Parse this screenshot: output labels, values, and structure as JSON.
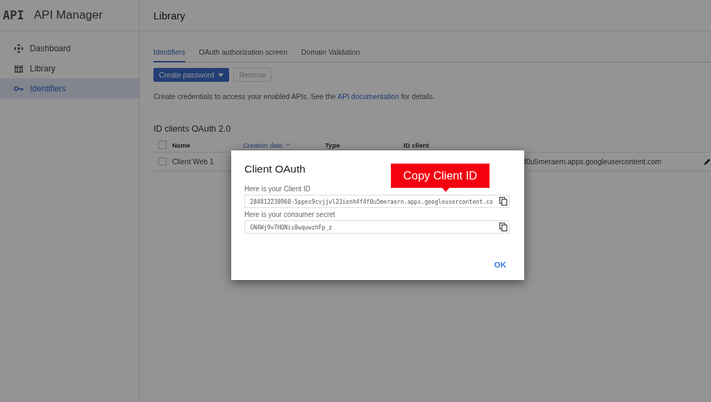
{
  "app": {
    "logo": "API",
    "title": "API Manager"
  },
  "sidebar": {
    "items": [
      {
        "label": "Dashboard",
        "selected": false
      },
      {
        "label": "Library",
        "selected": false
      },
      {
        "label": "Identifiers",
        "selected": true
      }
    ]
  },
  "page": {
    "title": "Library"
  },
  "tabs": [
    {
      "label": "Identifiers",
      "selected": true
    },
    {
      "label": "OAuth authorization screen",
      "selected": false
    },
    {
      "label": "Domain Validation",
      "selected": false
    }
  ],
  "toolbar": {
    "create_button": "Create password",
    "remove_button": {
      "label": "Remove",
      "disabled": true
    }
  },
  "intro": {
    "before": "Create credentials to access your enabled APIs. See the",
    "link": "API documentation",
    "after": "for details."
  },
  "table": {
    "title": "ID clients OAuth 2.0",
    "all_checked": false,
    "columns": [
      {
        "label": "Name",
        "sorted": false
      },
      {
        "label": "Creation date",
        "sorted": true
      },
      {
        "label": "Type",
        "sorted": false
      },
      {
        "label": "ID client",
        "sorted": false
      }
    ],
    "rows": [
      {
        "name": "Client Web 1",
        "id_client": "f0u5meraern.apps.googleusercontent.com",
        "checked": false
      }
    ]
  },
  "dialog": {
    "title": "Client OAuth",
    "fields": [
      {
        "label": "Here is your Client ID",
        "value": "284812238960-5ppes9cvjjvl23ionh4f4f0u5meraern.apps.googleusercontent.co"
      },
      {
        "label": "Here is your consumer secret",
        "value": "GN4Wj9v7HQNis0wquwzhFp_z"
      }
    ],
    "ok_button": "OK"
  },
  "callout": {
    "text": "Copy Client ID"
  }
}
